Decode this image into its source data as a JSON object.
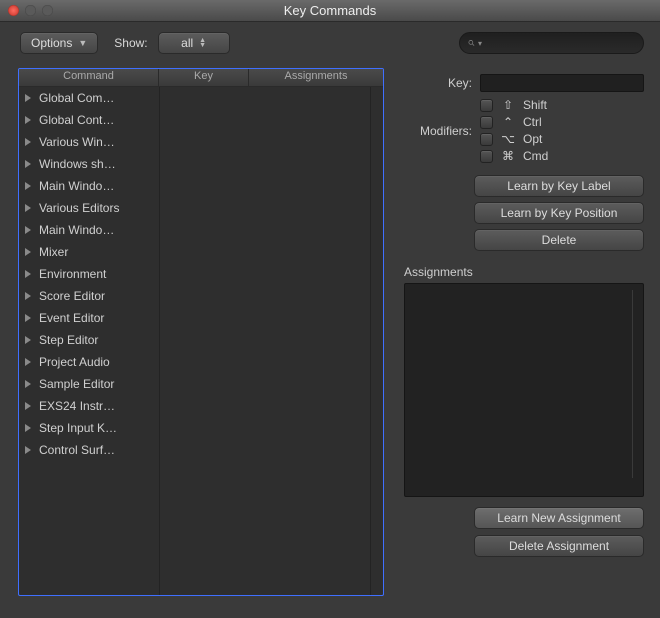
{
  "window": {
    "title": "Key Commands"
  },
  "toolbar": {
    "options_label": "Options",
    "show_label": "Show:",
    "show_value": "all"
  },
  "search": {
    "placeholder": ""
  },
  "table": {
    "headers": {
      "command": "Command",
      "key": "Key",
      "assignments": "Assignments"
    },
    "rows": [
      {
        "label": "Global Com…"
      },
      {
        "label": "Global Cont…"
      },
      {
        "label": "Various Win…"
      },
      {
        "label": "Windows sh…"
      },
      {
        "label": "Main Windo…"
      },
      {
        "label": "Various Editors"
      },
      {
        "label": "Main Windo…"
      },
      {
        "label": "Mixer"
      },
      {
        "label": "Environment"
      },
      {
        "label": "Score Editor"
      },
      {
        "label": "Event Editor"
      },
      {
        "label": "Step Editor"
      },
      {
        "label": "Project Audio"
      },
      {
        "label": "Sample Editor"
      },
      {
        "label": "EXS24 Instr…"
      },
      {
        "label": "Step Input K…"
      },
      {
        "label": "Control Surf…"
      }
    ]
  },
  "detail": {
    "key_label": "Key:",
    "modifiers_label": "Modifiers:",
    "modifiers": [
      {
        "symbol": "⇧",
        "name": "Shift"
      },
      {
        "symbol": "⌃",
        "name": "Ctrl"
      },
      {
        "symbol": "⌥",
        "name": "Opt"
      },
      {
        "symbol": "⌘",
        "name": "Cmd"
      }
    ],
    "learn_label": "Learn by Key Label",
    "learn_position": "Learn by Key Position",
    "delete": "Delete",
    "assignments_heading": "Assignments",
    "learn_new": "Learn New Assignment",
    "delete_assignment": "Delete Assignment"
  }
}
